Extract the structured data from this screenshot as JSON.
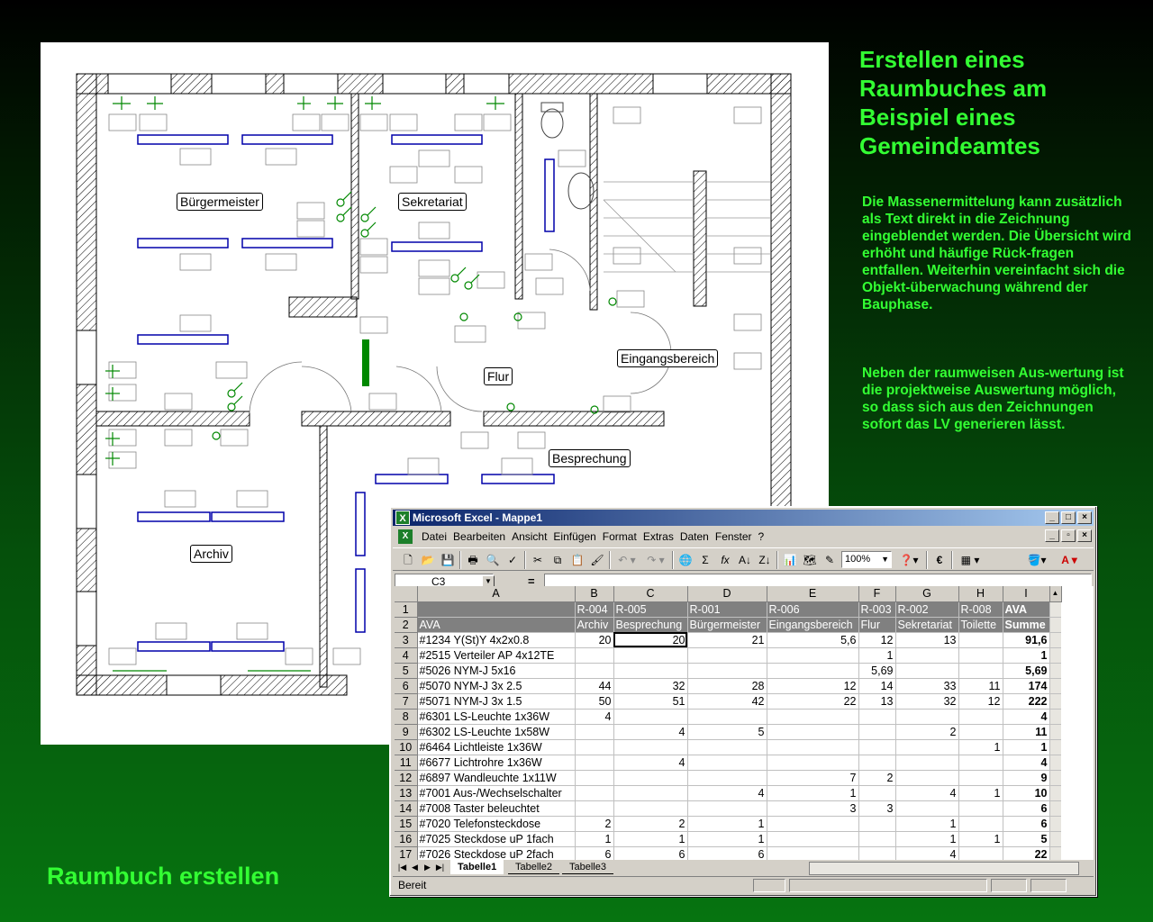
{
  "slide": {
    "title": "Erstellen eines Raumbuches am Beispiel eines Gemeindeamtes",
    "paragraph1": "Die Massenermittelung kann zusätzlich als Text direkt in die Zeichnung eingeblendet werden. Die Übersicht wird erhöht und häufige Rück-fragen entfallen. Weiterhin vereinfacht sich die Objekt-überwachung während der Bauphase.",
    "paragraph2": "Neben der raumweisen Aus-wertung ist die projektweise Auswertung möglich, so dass sich aus den Zeichnungen sofort das LV generieren lässt.",
    "footer": "Raumbuch erstellen"
  },
  "drawing": {
    "rooms": [
      "Bürgermeister",
      "Sekretariat",
      "Flur",
      "Eingangsbereich",
      "Besprechung",
      "Archiv"
    ]
  },
  "excel": {
    "window_title": "Microsoft Excel - Mappe1",
    "menus": [
      "Datei",
      "Bearbeiten",
      "Ansicht",
      "Einfügen",
      "Format",
      "Extras",
      "Daten",
      "Fenster",
      "?"
    ],
    "zoom": "100%",
    "name_box": "C3",
    "formula_eq": "=",
    "columns": [
      "A",
      "B",
      "C",
      "D",
      "E",
      "F",
      "G",
      "H",
      "I"
    ],
    "header_row1": [
      "",
      "R-004",
      "R-005",
      "R-001",
      "R-006",
      "R-003",
      "R-002",
      "R-008",
      "AVA"
    ],
    "header_row2": [
      "AVA",
      "Archiv",
      "Besprechung",
      "Bürgermeister",
      "Eingangsbereich",
      "Flur",
      "Sekretariat",
      "Toilette",
      "Summe"
    ],
    "rows": [
      {
        "n": "3",
        "cells": [
          "#1234 Y(St)Y 4x2x0.8",
          "20",
          "20",
          "21",
          "5,6",
          "12",
          "13",
          "",
          "91,6"
        ]
      },
      {
        "n": "4",
        "cells": [
          "#2515 Verteiler AP 4x12TE",
          "",
          "",
          "",
          "",
          "1",
          "",
          "",
          "1"
        ]
      },
      {
        "n": "5",
        "cells": [
          "#5026 NYM-J 5x16",
          "",
          "",
          "",
          "",
          "5,69",
          "",
          "",
          "5,69"
        ]
      },
      {
        "n": "6",
        "cells": [
          "#5070 NYM-J 3x 2.5",
          "44",
          "32",
          "28",
          "12",
          "14",
          "33",
          "11",
          "174"
        ]
      },
      {
        "n": "7",
        "cells": [
          "#5071 NYM-J 3x 1.5",
          "50",
          "51",
          "42",
          "22",
          "13",
          "32",
          "12",
          "222"
        ]
      },
      {
        "n": "8",
        "cells": [
          "#6301 LS-Leuchte 1x36W",
          "4",
          "",
          "",
          "",
          "",
          "",
          "",
          "4"
        ]
      },
      {
        "n": "9",
        "cells": [
          "#6302 LS-Leuchte 1x58W",
          "",
          "4",
          "5",
          "",
          "",
          "2",
          "",
          "11"
        ]
      },
      {
        "n": "10",
        "cells": [
          "#6464 Lichtleiste 1x36W",
          "",
          "",
          "",
          "",
          "",
          "",
          "1",
          "1"
        ]
      },
      {
        "n": "11",
        "cells": [
          "#6677 Lichtrohre 1x36W",
          "",
          "4",
          "",
          "",
          "",
          "",
          "",
          "4"
        ]
      },
      {
        "n": "12",
        "cells": [
          "#6897 Wandleuchte 1x11W",
          "",
          "",
          "",
          "7",
          "2",
          "",
          "",
          "9"
        ]
      },
      {
        "n": "13",
        "cells": [
          "#7001 Aus-/Wechselschalter",
          "",
          "",
          "4",
          "1",
          "",
          "4",
          "1",
          "10"
        ]
      },
      {
        "n": "14",
        "cells": [
          "#7008 Taster beleuchtet",
          "",
          "",
          "",
          "3",
          "3",
          "",
          "",
          "6"
        ]
      },
      {
        "n": "15",
        "cells": [
          "#7020 Telefonsteckdose",
          "2",
          "2",
          "1",
          "",
          "",
          "1",
          "",
          "6"
        ]
      },
      {
        "n": "16",
        "cells": [
          "#7025 Steckdose uP 1fach",
          "1",
          "1",
          "1",
          "",
          "",
          "1",
          "1",
          "5"
        ]
      },
      {
        "n": "17",
        "cells": [
          "#7026 Steckdose uP 2fach",
          "6",
          "6",
          "6",
          "",
          "",
          "4",
          "",
          "22"
        ]
      }
    ],
    "sheet_tabs": [
      "Tabelle1",
      "Tabelle2",
      "Tabelle3"
    ],
    "status": "Bereit"
  }
}
